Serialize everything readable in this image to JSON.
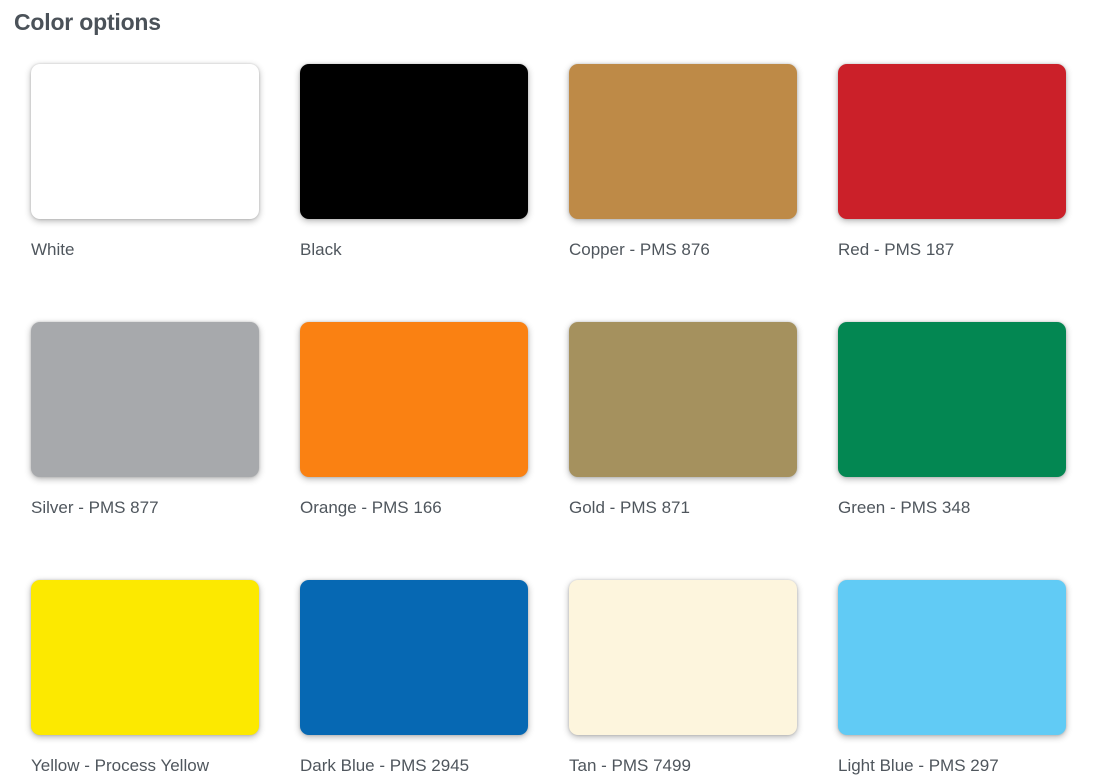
{
  "page": {
    "title": "Color options",
    "background": "#ffffff",
    "title_color": "#4b5259",
    "label_color": "#4f565d"
  },
  "swatches": [
    {
      "label": "White",
      "color": "#ffffff"
    },
    {
      "label": "Black",
      "color": "#000000"
    },
    {
      "label": "Copper - PMS 876",
      "color": "#be8a47"
    },
    {
      "label": "Red - PMS 187",
      "color": "#cb2029"
    },
    {
      "label": "Silver - PMS 877",
      "color": "#a7a9ac"
    },
    {
      "label": "Orange - PMS 166",
      "color": "#fa8112"
    },
    {
      "label": "Gold - PMS 871",
      "color": "#a5915e"
    },
    {
      "label": "Green - PMS 348",
      "color": "#038752"
    },
    {
      "label": "Yellow - Process Yellow",
      "color": "#fce900"
    },
    {
      "label": "Dark Blue - PMS 2945",
      "color": "#0668b3"
    },
    {
      "label": "Tan - PMS 7499",
      "color": "#fdf5dd"
    },
    {
      "label": "Light Blue - PMS 297",
      "color": "#61cbf5"
    }
  ]
}
